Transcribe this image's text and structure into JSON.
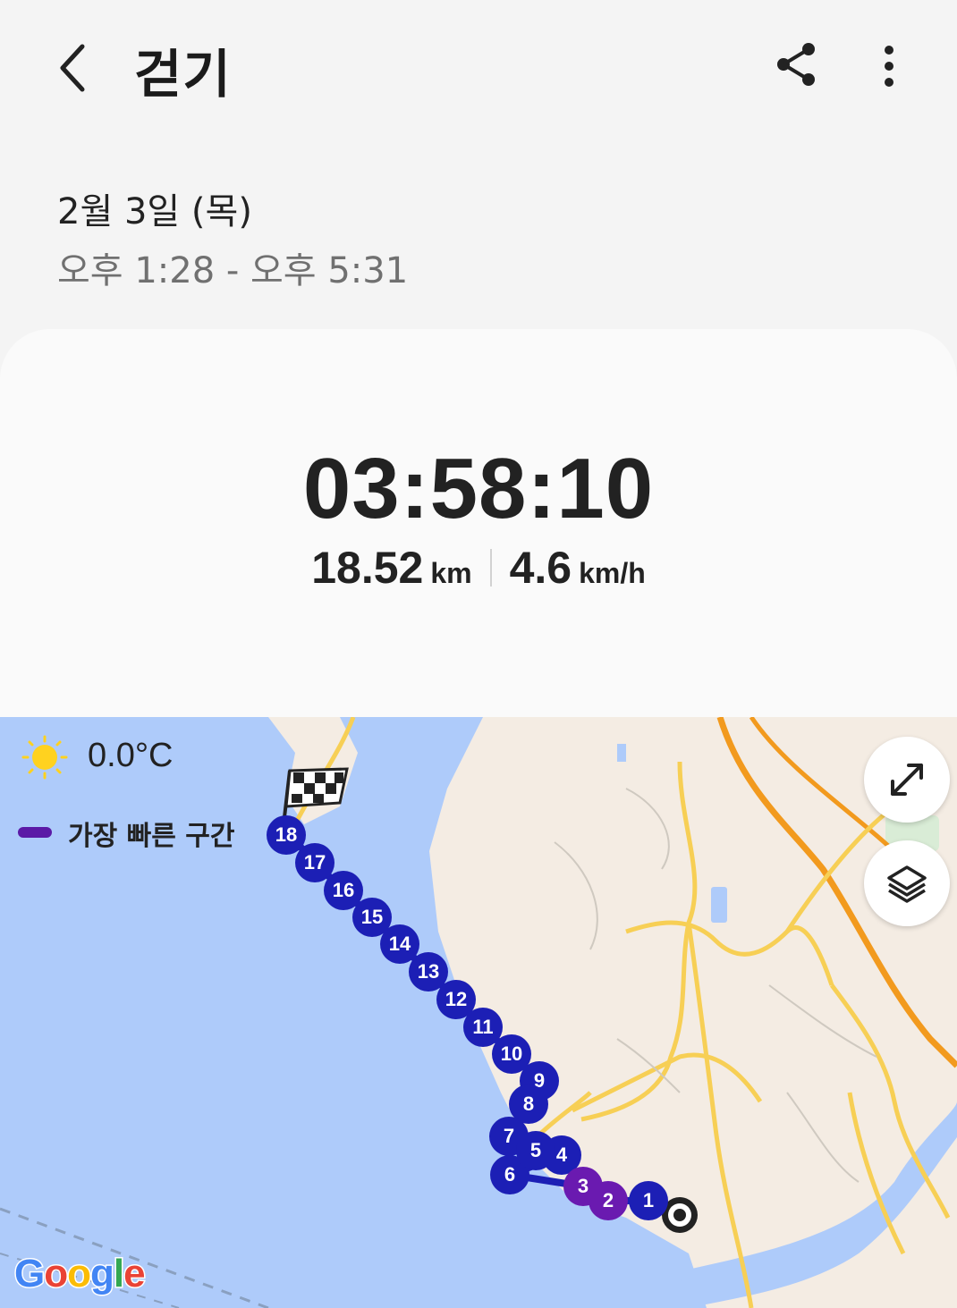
{
  "header": {
    "title": "걷기",
    "back_icon": "chevron-left-icon",
    "share_icon": "share-icon",
    "more_icon": "more-vertical-icon"
  },
  "session": {
    "date": "2월 3일 (목)",
    "time_range": "오후 1:28 - 오후 5:31"
  },
  "summary": {
    "duration": "03:58:10",
    "distance_value": "18.52",
    "distance_unit": "km",
    "speed_value": "4.6",
    "speed_unit": "km/h"
  },
  "map": {
    "temperature": "0.0°C",
    "weather_icon": "sun-icon",
    "legend_label": "가장 빠른 구간",
    "legend_color": "#5b1aa6",
    "expand_icon": "expand-icon",
    "layers_icon": "layers-icon",
    "finish_icon": "checkered-flag-icon",
    "start_icon": "start-point-icon",
    "attribution": "Google",
    "lap_markers": [
      "1",
      "2",
      "3",
      "4",
      "5",
      "6",
      "7",
      "8",
      "9",
      "10",
      "11",
      "12",
      "13",
      "14",
      "15",
      "16",
      "17",
      "18"
    ],
    "fastest_laps": [
      "2",
      "3"
    ],
    "colors": {
      "water": "#aecbfa",
      "land": "#f4ece3",
      "road": "#f7cf55",
      "highway": "#f29a1e",
      "lap": "#1c1fb5",
      "fast_lap": "#6a1ab0"
    }
  }
}
